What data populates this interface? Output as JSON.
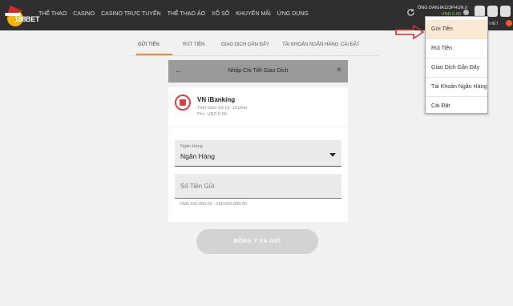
{
  "logo": {
    "text": "188BET"
  },
  "nav": [
    "THỂ THAO",
    "CASINO",
    "CASINO TRỰC TUYẾN",
    "THỂ THAO ẢO",
    "XỔ SỐ",
    "KHUYẾN MÃI",
    "ỨNG DỤNG"
  ],
  "account": {
    "username": "ÔNG DAIGIA123PHUN.II",
    "balance": "VND 0.00",
    "language": "NG VIỆT"
  },
  "tabs": [
    "GỬI TIỀN",
    "RÚT TIỀN",
    "GIAO DỊCH GẦN ĐÂY",
    "TÀI KHOẢN NGÂN HÀNG",
    "CÀI ĐẶT"
  ],
  "panel": {
    "title": "Nhập Chi Tiết Giao Dịch",
    "method": {
      "name": "VN iBanking",
      "time": "Thời Gian Xử Lý: 10 phút",
      "fee": "Phí : VND 0.00"
    },
    "bank_select": {
      "label": "Ngân Hàng",
      "value": "Ngân Hàng"
    },
    "amount": {
      "placeholder": "Số Tiền Gửi",
      "hint": "VND 100,000.00 - 100,000,000.00"
    },
    "submit_label": "ĐỒNG Ý VÀ GỬI"
  },
  "dropdown": [
    "Gửi Tiền",
    "Rút Tiền",
    "Giao Dịch Gần Đây",
    "Tài Khoản Ngân Hàng",
    "Cài Đặt"
  ],
  "colors": {
    "accent": "#f08a28",
    "topbar": "#2f2f2f",
    "arrow": "#d62b2b"
  }
}
